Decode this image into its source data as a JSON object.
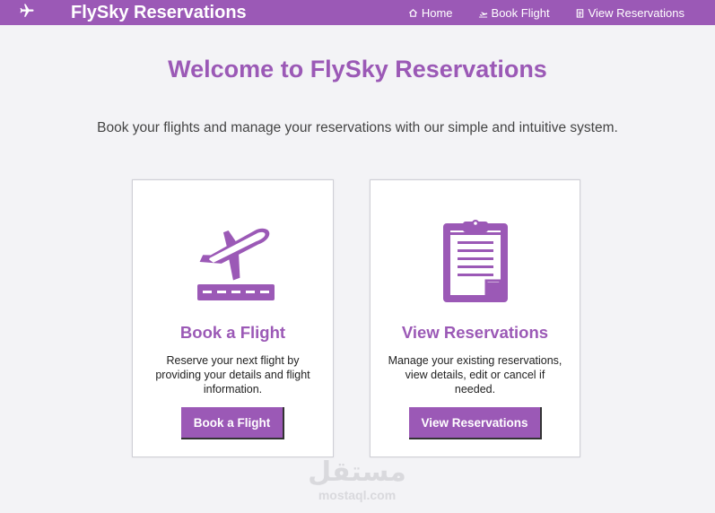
{
  "nav": {
    "brand": "FlySky Reservations",
    "links": [
      {
        "label": "Home",
        "icon": "home-icon"
      },
      {
        "label": "Book Flight",
        "icon": "plane-departure-icon"
      },
      {
        "label": "View Reservations",
        "icon": "clipboard-icon"
      }
    ]
  },
  "main": {
    "title": "Welcome to FlySky Reservations",
    "subtitle": "Book your flights and manage your reservations with our simple and intuitive system."
  },
  "cards": [
    {
      "title": "Book a Flight",
      "description": "Reserve your next flight by providing your details and flight information.",
      "button": "Book a Flight",
      "icon": "plane-takeoff-icon"
    },
    {
      "title": "View Reservations",
      "description": "Manage your existing reservations, view details, edit or cancel if needed.",
      "button": "View Reservations",
      "icon": "clipboard-list-icon"
    }
  ],
  "watermark": {
    "arabic": "مستقل",
    "latin": "mostaql.com"
  },
  "colors": {
    "accent": "#9b59b6",
    "background": "#f3f3f6",
    "text": "#444444"
  }
}
